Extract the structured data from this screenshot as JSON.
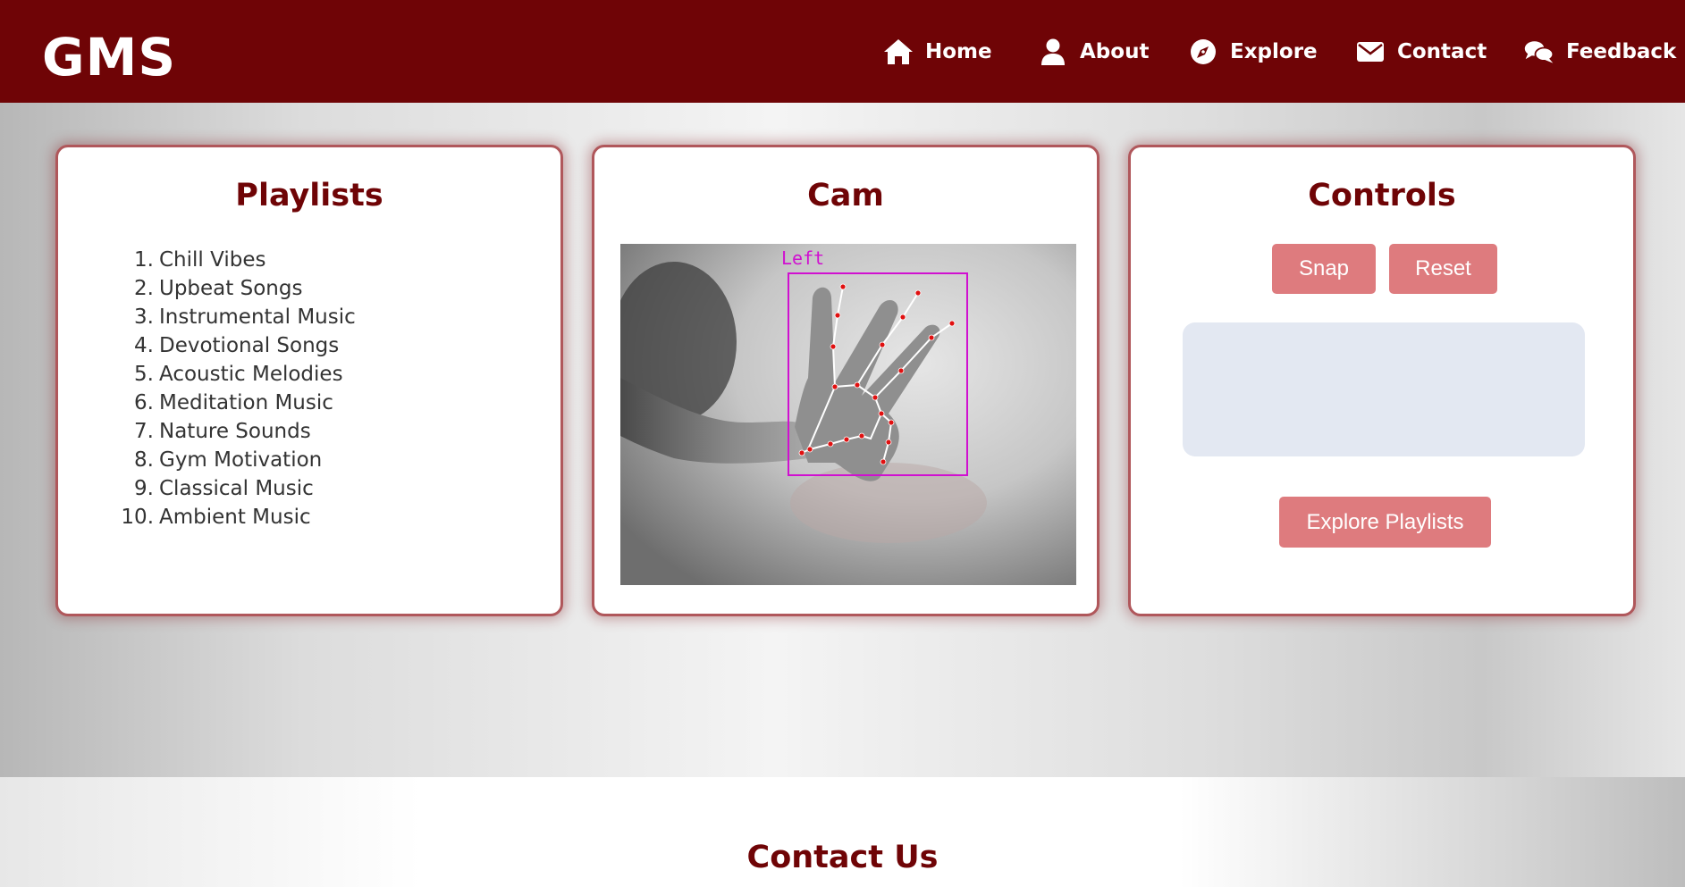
{
  "nav": {
    "logo": "GMS",
    "items": [
      {
        "label": "Home",
        "icon": "home-icon"
      },
      {
        "label": "About",
        "icon": "user-icon"
      },
      {
        "label": "Explore",
        "icon": "compass-icon"
      },
      {
        "label": "Contact",
        "icon": "envelope-icon"
      },
      {
        "label": "Feedback",
        "icon": "comments-icon"
      }
    ]
  },
  "playlists": {
    "title": "Playlists",
    "items": [
      {
        "num": "1.",
        "name": "Chill Vibes"
      },
      {
        "num": "2.",
        "name": "Upbeat Songs"
      },
      {
        "num": "3.",
        "name": "Instrumental Music"
      },
      {
        "num": "4.",
        "name": "Devotional Songs"
      },
      {
        "num": "5.",
        "name": "Acoustic Melodies"
      },
      {
        "num": "6.",
        "name": "Meditation Music"
      },
      {
        "num": "7.",
        "name": "Nature Sounds"
      },
      {
        "num": "8.",
        "name": "Gym Motivation"
      },
      {
        "num": "9.",
        "name": "Classical Music"
      },
      {
        "num": "10.",
        "name": "Ambient Music"
      }
    ]
  },
  "cam": {
    "title": "Cam",
    "hand_label": "Left"
  },
  "controls": {
    "title": "Controls",
    "snap_label": "Snap",
    "reset_label": "Reset",
    "result_text": "",
    "explore_label": "Explore Playlists"
  },
  "footer": {
    "contact_heading": "Contact Us"
  },
  "colors": {
    "brand": "#6f0406",
    "button": "#de7b7e",
    "result_box": "#e3e8f2"
  }
}
